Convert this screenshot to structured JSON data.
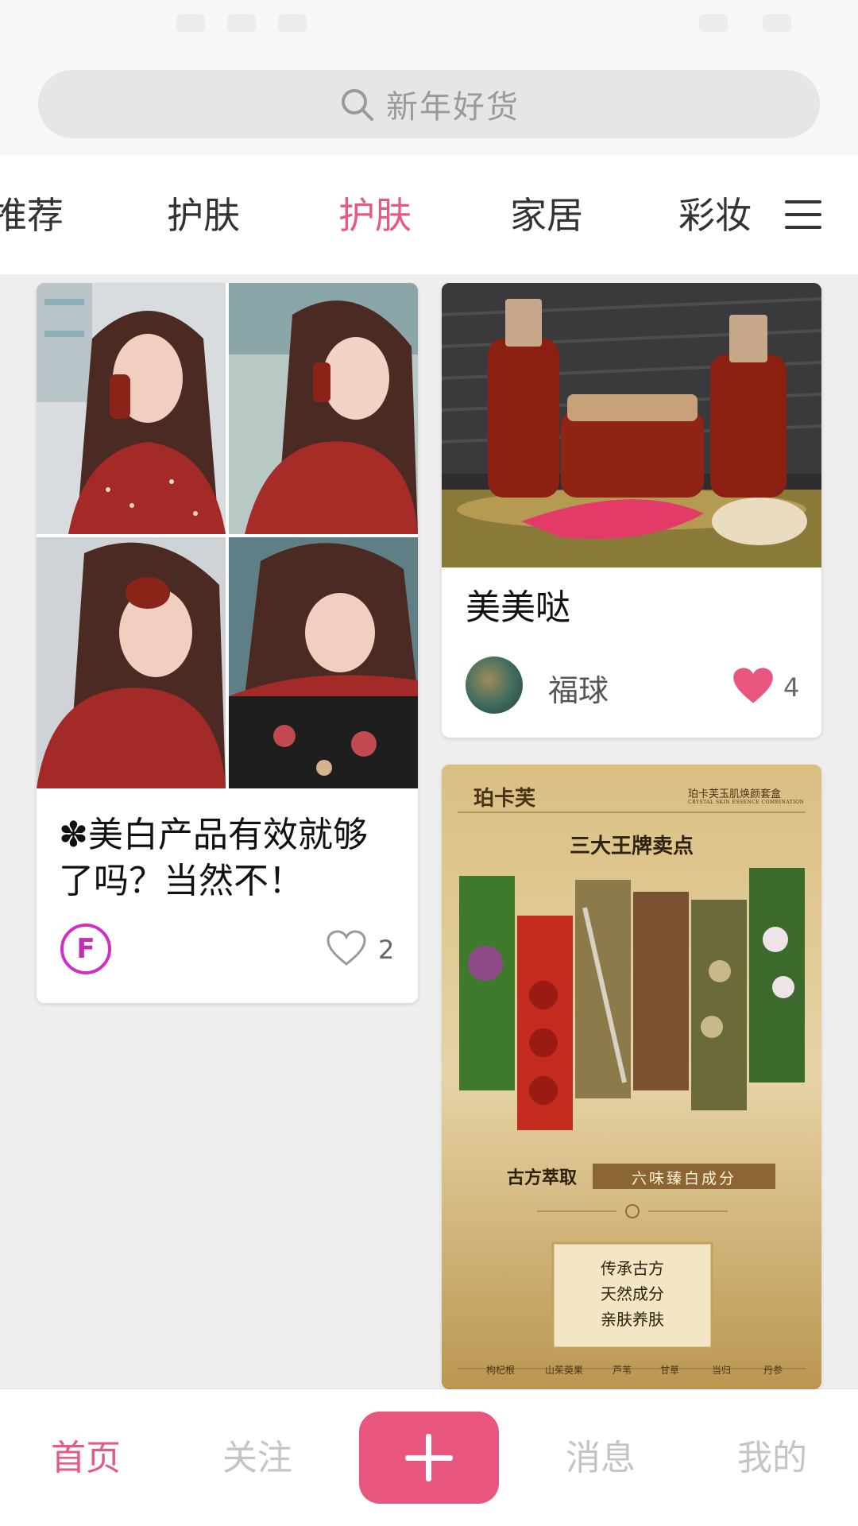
{
  "search": {
    "placeholder": "新年好货"
  },
  "tabs": [
    {
      "label": "推荐",
      "active": false
    },
    {
      "label": "护肤",
      "active": false
    },
    {
      "label": "护肤",
      "active": true
    },
    {
      "label": "家居",
      "active": false
    },
    {
      "label": "彩妆",
      "active": false
    }
  ],
  "feed": {
    "card1": {
      "title": "✽美白产品有效就够了吗？当然不！",
      "author_avatar_letter": "F",
      "likes": "2",
      "liked": false
    },
    "card2": {
      "title": "美美哒",
      "author": "福球",
      "likes": "4",
      "liked": true
    },
    "card3": {
      "brand": "珀卡芙",
      "product_line": "珀卡芙玉肌焕颜套盒",
      "product_line_en": "CRYSTAL SKIN ESSENCE COMBINATION",
      "headline": "三大王牌卖点",
      "subtitle_left": "古方萃取",
      "subtitle_right": "六味臻白成分",
      "slogan_lines": [
        "传承古方",
        "天然成分",
        "亲肤养肤"
      ],
      "ingredients": [
        "枸杞根",
        "山茱萸果",
        "芦苇",
        "甘草",
        "当归",
        "丹参"
      ]
    }
  },
  "bottom_nav": {
    "home": "首页",
    "follow": "关注",
    "messages": "消息",
    "me": "我的"
  },
  "colors": {
    "accent": "#e45a84",
    "button": "#e8557f",
    "inactive_nav": "#c4c4c4"
  },
  "icons": {
    "search": "search-icon",
    "menu": "menu-icon",
    "heart_filled": "heart-filled-icon",
    "heart_outline": "heart-outline-icon",
    "add": "plus-icon"
  }
}
